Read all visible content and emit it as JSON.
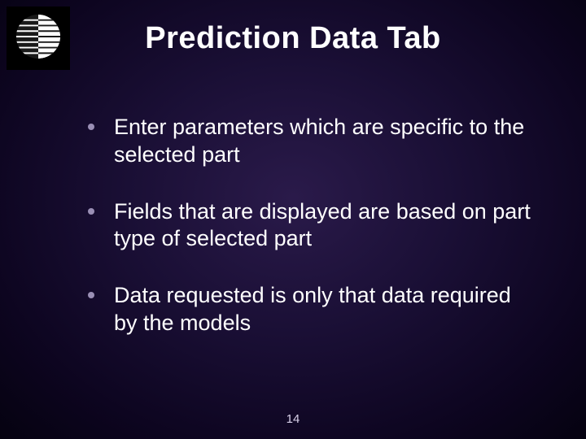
{
  "title": "Prediction Data Tab",
  "bullets": [
    "Enter parameters which are specific to the selected part",
    "Fields that are displayed are based on part type of selected part",
    "Data requested is only that data required by the models"
  ],
  "page_number": "14"
}
